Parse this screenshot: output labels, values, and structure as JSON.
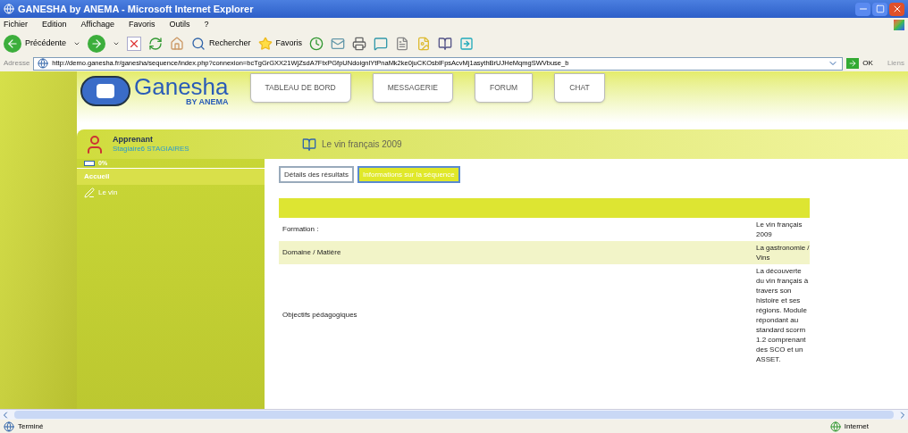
{
  "window": {
    "title": "GANESHA by ANEMA - Microsoft Internet Explorer"
  },
  "menu": [
    "Fichier",
    "Edition",
    "Affichage",
    "Favoris",
    "Outils",
    "?"
  ],
  "toolbar": {
    "back": "Précédente",
    "search": "Rechercher",
    "favorites": "Favoris"
  },
  "address_bar": {
    "label": "Adresse",
    "url": "http://demo.ganesha.fr/ganesha/sequence/index.php?connexion=bcTgGrGXX21WjZsdA7FtxPGfpUNdoignlYtPnaMk2ke0juCKOsblFpsAcvMj1asythBrUJHeMqmgSWVbuse_b",
    "go": "OK",
    "links": "Liens"
  },
  "site": {
    "logo": "Ganesha",
    "logo_sub": "BY ANEMA",
    "nav": [
      "TABLEAU DE BORD",
      "MESSAGERIE",
      "FORUM",
      "CHAT"
    ],
    "user": {
      "role": "Apprenant",
      "name": "Stagiaire6 STAGIAIRES"
    },
    "progress": {
      "reading": "0%",
      "level": 0
    },
    "sidebar": {
      "items": [
        {
          "label": "Accueil",
          "selected": true
        },
        {
          "label": "Le vin",
          "selected": false
        }
      ]
    },
    "course_title": "Le vin français 2009",
    "tabs": [
      {
        "label": "Détails des résultats",
        "selected": false
      },
      {
        "label": "Informations sur la séquence",
        "selected": true
      }
    ],
    "rows": [
      {
        "label": "Formation :",
        "value": "Le vin français 2009"
      },
      {
        "label": "Domaine / Matière",
        "value": "La gastronomie / Vins"
      },
      {
        "label": "Objectifs pédagogiques",
        "value": "La découverte du vin français à travers son histoire et ses régions. Module répondant au standard scorm 1.2 comprenant des SCO et un ASSET."
      }
    ]
  },
  "status_bar": {
    "text": "Terminé",
    "zone": "Internet"
  }
}
